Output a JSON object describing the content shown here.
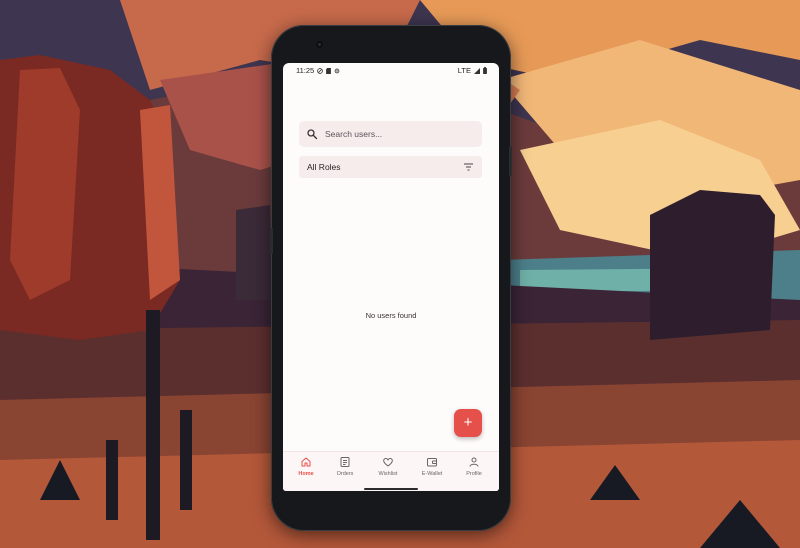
{
  "status_bar": {
    "time": "11:25",
    "network": "LTE"
  },
  "search": {
    "placeholder": "Search users...",
    "value": ""
  },
  "role_filter": {
    "selected": "All Roles"
  },
  "empty_state": {
    "message": "No users found"
  },
  "fab": {
    "label": "+"
  },
  "bottom_nav": {
    "items": [
      {
        "label": "Home",
        "icon": "home-icon",
        "active": true
      },
      {
        "label": "Orders",
        "icon": "orders-icon",
        "active": false
      },
      {
        "label": "Wishlist",
        "icon": "heart-icon",
        "active": false
      },
      {
        "label": "E-Wallet",
        "icon": "wallet-icon",
        "active": false
      },
      {
        "label": "Profile",
        "icon": "person-icon",
        "active": false
      }
    ]
  },
  "colors": {
    "accent": "#e6504b",
    "surface": "#fefbfb",
    "field": "#f7ecec"
  }
}
